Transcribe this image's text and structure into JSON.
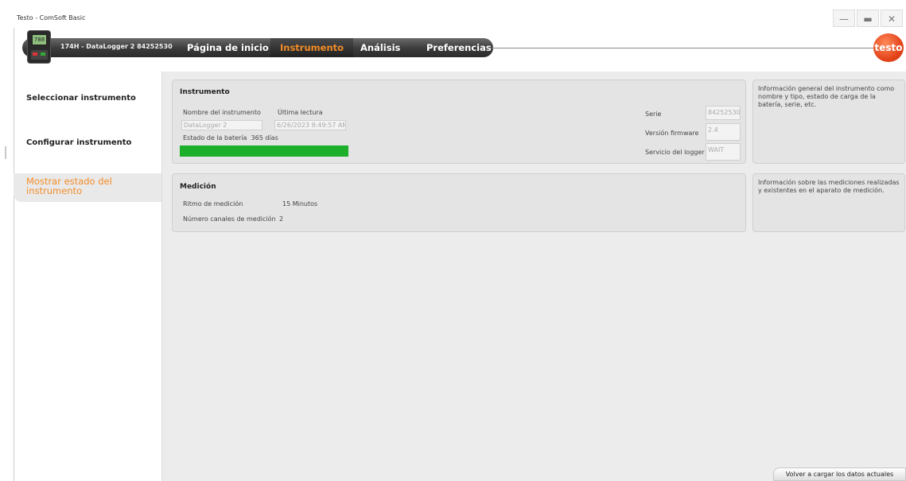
{
  "window": {
    "title": "Testo - ComSoft Basic",
    "controls": [
      "—",
      "▬",
      "✕"
    ]
  },
  "device": {
    "label": "174H - DataLogger 2 84252530",
    "screen": "788"
  },
  "nav": {
    "tabs": [
      "Página de inicio",
      "Instrumento",
      "Análisis",
      "Preferencias"
    ],
    "active": "Instrumento"
  },
  "logo": "testo",
  "sidebar": {
    "items": [
      "Seleccionar instrumento",
      "Configurar instrumento",
      "Mostrar estado del instrumento"
    ]
  },
  "instrument_panel": {
    "title": "Instrumento",
    "name_label": "Nombre del instrumento",
    "name_value": "DataLogger 2",
    "last_read_label": "Última lectura",
    "last_read_value": "6/26/2023 8:49:57 AM",
    "battery_label": "Estado de la batería",
    "battery_value": "365",
    "battery_unit": "días",
    "battery_fill": 1.0,
    "serial_label": "Serie",
    "serial_value": "84252530",
    "firmware_label": "Versión firmware",
    "firmware_value": "2.4",
    "service_label": "Servicio del logger",
    "service_value": "WAIT"
  },
  "instrument_info": "Información general del instrumento como nombre y tipo, estado de carga de la batería, serie, etc.",
  "measure_panel": {
    "title": "Medición",
    "rate_label": "Ritmo de medición",
    "rate_value": "15 Minutos",
    "channels_label": "Número canales de medición",
    "channels_value": "2"
  },
  "measure_info": "Información sobre las mediciones realizadas y existentes en el aparato de medición.",
  "reload_button": "Volver a cargar los datos actuales",
  "colors": {
    "accent": "#f28c28",
    "battery": "#1dae2a",
    "logo": "#e5461c"
  }
}
